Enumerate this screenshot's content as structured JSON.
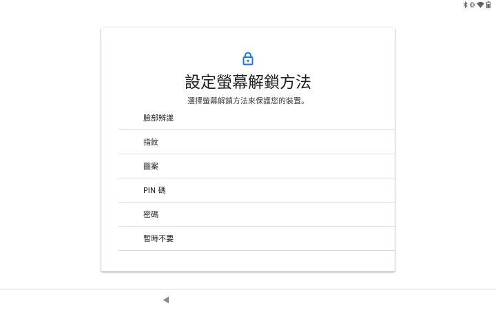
{
  "status_bar": {
    "icons": [
      "bluetooth-icon",
      "vibrate-icon",
      "wifi-icon",
      "battery-icon"
    ]
  },
  "card": {
    "lock_icon": "lock-icon",
    "accent_color": "#1a73e8",
    "title": "設定螢幕解鎖方法",
    "subtitle": "選擇螢幕解鎖方法來保護您的裝置。",
    "options": [
      {
        "label": "臉部辨識"
      },
      {
        "label": "指紋"
      },
      {
        "label": "圖案"
      },
      {
        "label": "PIN 碼"
      },
      {
        "label": "密碼"
      },
      {
        "label": "暫時不要"
      }
    ]
  },
  "nav_bar": {
    "back_icon": "back-triangle-icon"
  }
}
